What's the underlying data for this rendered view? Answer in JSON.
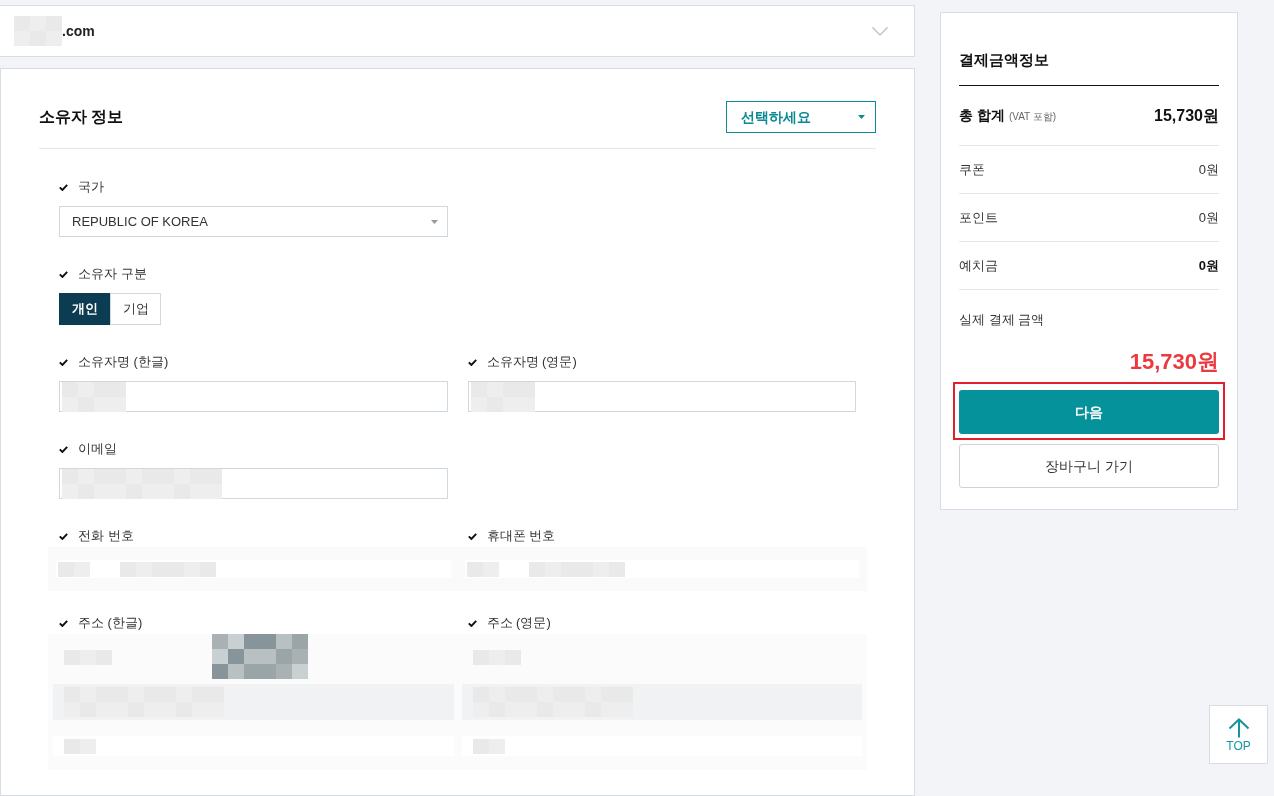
{
  "top_card": {
    "domain": {
      "redacted": true,
      "suffix": ".com"
    },
    "expanded": false
  },
  "owner_info": {
    "title": "소유자 정보",
    "type_select": {
      "value": "선택하세요"
    },
    "rows": [
      [
        {
          "kind": "select",
          "label": "국가",
          "value": "REPUBLIC OF KOREA"
        }
      ],
      [
        {
          "kind": "toggle",
          "label": "소유자 구분",
          "options": [
            {
              "label": "개인",
              "selected": true
            },
            {
              "label": "기업",
              "selected": false
            }
          ]
        }
      ],
      [
        {
          "kind": "input",
          "label": "소유자명 (한글)",
          "redacted": true
        },
        {
          "kind": "input",
          "label": "소유자명 (영문)",
          "redacted": true
        }
      ],
      [
        {
          "kind": "input",
          "label": "이메일",
          "redacted": true
        }
      ],
      [
        {
          "kind": "phone",
          "label": "전화 번호",
          "redacted": true
        },
        {
          "kind": "phone",
          "label": "휴대폰 번호",
          "redacted": true
        }
      ],
      [
        {
          "kind": "address",
          "label": "주소 (한글)",
          "redacted": true
        },
        {
          "kind": "address",
          "label": "주소 (영문)",
          "redacted": true
        }
      ]
    ]
  },
  "payment_summary": {
    "title": "결제금액정보",
    "total": {
      "label": "총 합계",
      "note": "(VAT 포함)",
      "value": "15,730원"
    },
    "rows": [
      {
        "label": "쿠폰",
        "value": "0원",
        "emphasis": false
      },
      {
        "label": "포인트",
        "value": "0원",
        "emphasis": false
      },
      {
        "label": "예치금",
        "value": "0원",
        "emphasis": true
      }
    ],
    "final": {
      "label": "실제 결제 금액",
      "value": "15,730원"
    },
    "buttons": [
      {
        "kind": "primary",
        "label": "다음",
        "highlighted": true
      },
      {
        "kind": "secondary",
        "label": "장바구니 가기",
        "highlighted": false
      }
    ]
  },
  "top_button": {
    "label": "TOP"
  }
}
